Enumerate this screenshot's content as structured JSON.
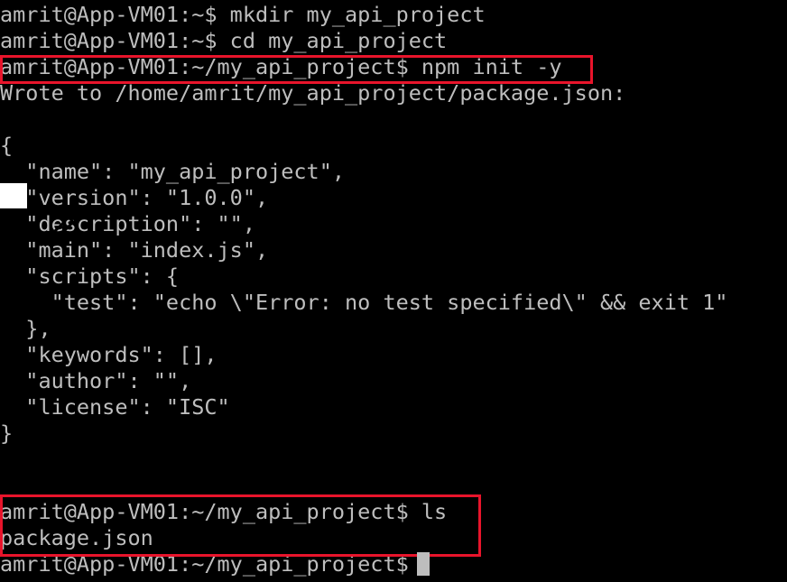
{
  "terminal": {
    "lines": [
      "amrit@App-VM01:~$ mkdir my_api_project",
      "amrit@App-VM01:~$ cd my_api_project",
      "amrit@App-VM01:~/my_api_project$ npm init -y",
      "Wrote to /home/amrit/my_api_project/package.json:",
      "",
      "{",
      "  \"name\": \"my_api_project\",",
      "  \"version\": \"1.0.0\",",
      "  \"description\": \"\",",
      "  \"main\": \"index.js\",",
      "  \"scripts\": {",
      "    \"test\": \"echo \\\"Error: no test specified\\\" && exit 1\"",
      "  },",
      "  \"keywords\": [],",
      "  \"author\": \"\",",
      "  \"license\": \"ISC\"",
      "}",
      "",
      "",
      "amrit@App-VM01:~/my_api_project$ ls",
      "package.json",
      "amrit@App-VM01:~/my_api_project$ "
    ]
  },
  "colors": {
    "background": "#000000",
    "foreground": "#bebebe",
    "highlight_box": "#e8142b",
    "cursor": "#bdbdbd"
  },
  "icons": {
    "line_marker": "double-chevron-right-icon"
  }
}
